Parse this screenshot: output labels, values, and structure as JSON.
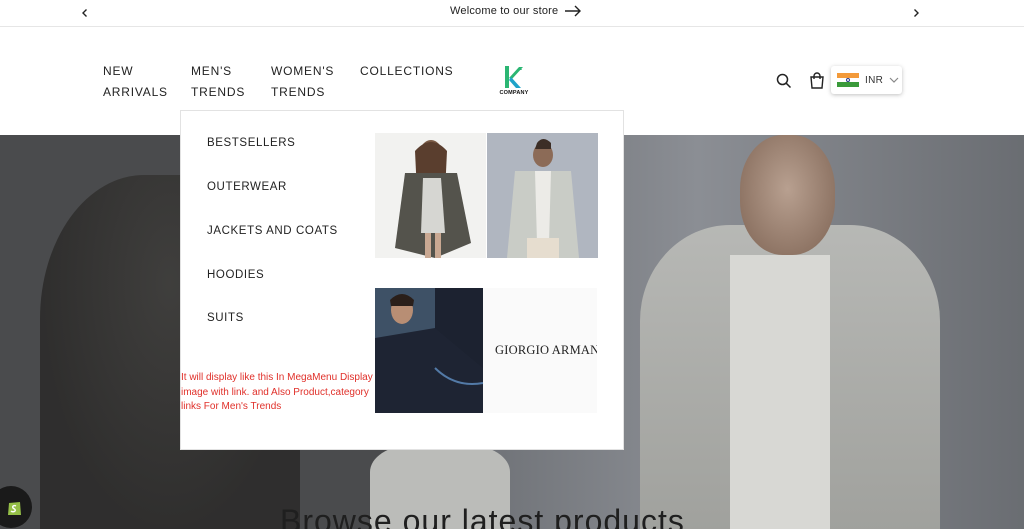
{
  "announcement": {
    "message": "Welcome to our store",
    "prev_icon": "chevron-left-icon",
    "next_icon": "chevron-right-icon",
    "arrow_icon": "arrow-right-icon"
  },
  "header": {
    "nav": [
      {
        "label": "NEW ARRIVALS"
      },
      {
        "label": "MEN'S TRENDS"
      },
      {
        "label": "WOMEN'S TRENDS"
      },
      {
        "label": "COLLECTIONS"
      }
    ],
    "logo_text": "COMPANY",
    "search_icon": "search-icon",
    "cart_icon": "cart-icon",
    "currency": {
      "code": "INR",
      "flag": "india-flag-icon",
      "dropdown_icon": "chevron-down-icon"
    }
  },
  "mega_menu": {
    "links": [
      {
        "label": "BESTSELLERS"
      },
      {
        "label": "OUTERWEAR"
      },
      {
        "label": "JACKETS AND COATS"
      },
      {
        "label": "HOODIES"
      },
      {
        "label": "SUITS"
      }
    ],
    "annotation": "It will display like this In MegaMenu Display image with link. and Also Product,category links For Men's Trends",
    "promo_brand": "GIORGIO ARMANI"
  },
  "hero": {
    "heading": "Browse our latest products"
  },
  "colors": {
    "accent_green": "#2bb673",
    "annotation_red": "#e0302a",
    "hero_dark": "#4a4b4d"
  }
}
